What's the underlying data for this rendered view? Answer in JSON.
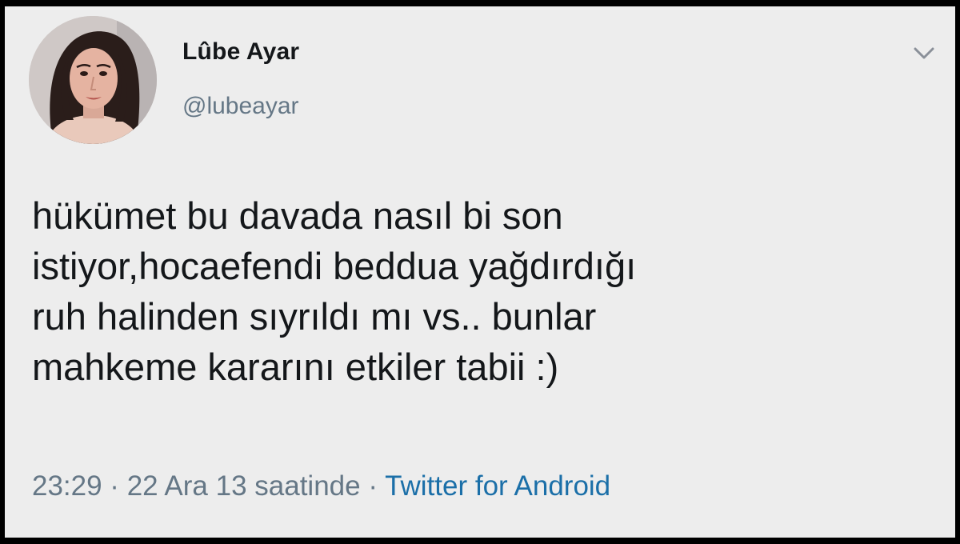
{
  "tweet": {
    "author": {
      "display_name": "Lûbe Ayar",
      "handle": "@lubeayar"
    },
    "menu_icon": "chevron-down-icon",
    "text_lines": [
      "hükümet bu davada nasıl bi son",
      "istiyor,hocaefendi beddua yağdırdığı",
      "ruh halinden sıyrıldı mı vs.. bunlar",
      "mahkeme kararını etkiler tabii :)"
    ],
    "timestamp": "23:29 · 22 Ara 13 saatinde",
    "separator": "·",
    "source": "Twitter for Android"
  },
  "colors": {
    "background": "#ededed",
    "text": "#14171a",
    "secondary_text": "#657786",
    "link": "#1b6fa8",
    "frame": "#000000"
  }
}
